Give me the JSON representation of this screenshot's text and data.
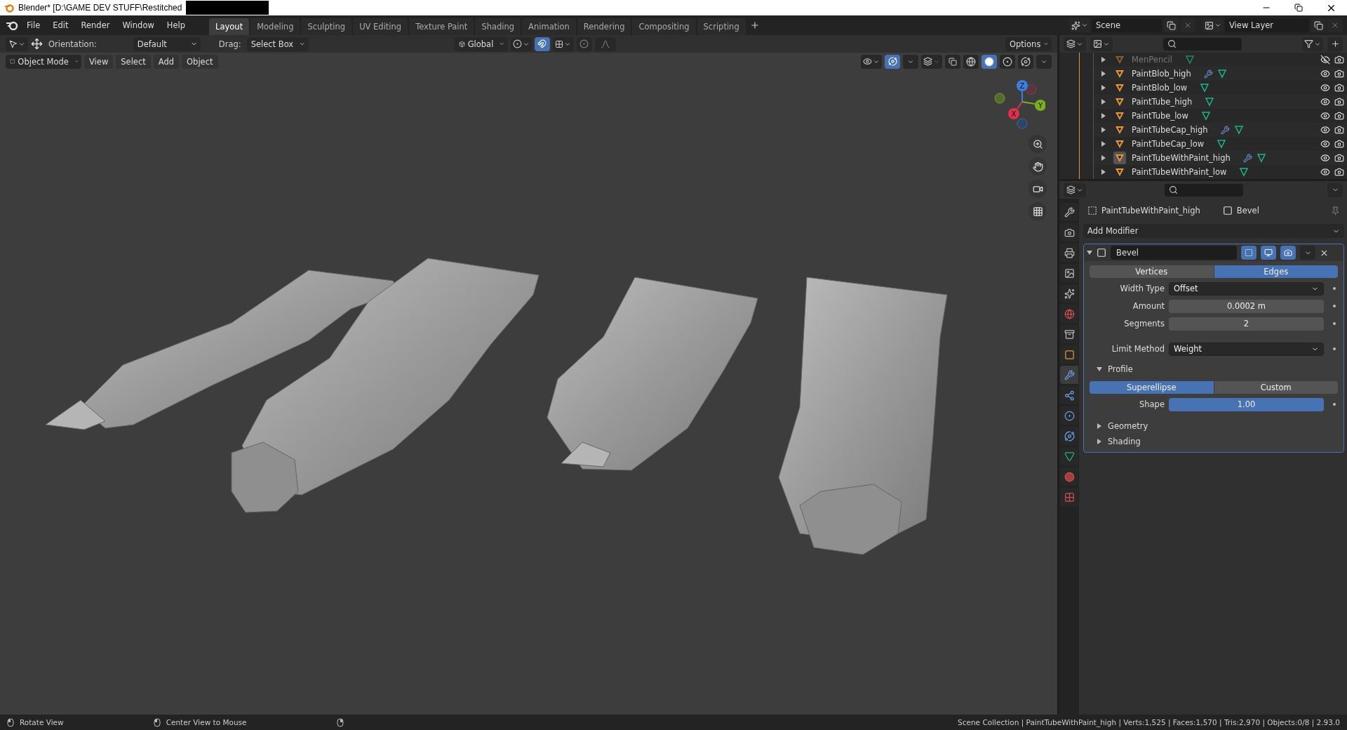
{
  "window": {
    "title": "Blender* [D:\\GAME DEV STUFF\\Restitched"
  },
  "menu": [
    "File",
    "Edit",
    "Render",
    "Window",
    "Help"
  ],
  "workspaces": [
    {
      "label": "Layout",
      "selected": true
    },
    {
      "label": "Modeling",
      "selected": false
    },
    {
      "label": "Sculpting",
      "selected": false
    },
    {
      "label": "UV Editing",
      "selected": false
    },
    {
      "label": "Texture Paint",
      "selected": false
    },
    {
      "label": "Shading",
      "selected": false
    },
    {
      "label": "Animation",
      "selected": false
    },
    {
      "label": "Rendering",
      "selected": false
    },
    {
      "label": "Compositing",
      "selected": false
    },
    {
      "label": "Scripting",
      "selected": false
    }
  ],
  "scene": "Scene",
  "view_layer": "View Layer",
  "tool_settings": {
    "orientation_label": "Orientation:",
    "orientation": "Default",
    "drag_label": "Drag:",
    "drag": "Select Box",
    "transform": "Global",
    "snap_on": true,
    "options": "Options"
  },
  "viewport_header": {
    "mode": "Object Mode",
    "menus": [
      "View",
      "Select",
      "Add",
      "Object"
    ],
    "gizmo_on": true,
    "shading": [
      {
        "kind": "wireframe",
        "selected": false
      },
      {
        "kind": "solid",
        "selected": true
      },
      {
        "kind": "material",
        "selected": false
      },
      {
        "kind": "rendered",
        "selected": false
      }
    ]
  },
  "gizmo": {
    "x": "X",
    "y": "Y",
    "z": "Z"
  },
  "outliner": {
    "items": [
      {
        "name": "MenPencil",
        "modifier": false,
        "visible": false,
        "active": false
      },
      {
        "name": "PaintBlob_high",
        "modifier": true,
        "visible": true,
        "active": false
      },
      {
        "name": "PaintBlob_low",
        "modifier": false,
        "visible": true,
        "active": false
      },
      {
        "name": "PaintTube_high",
        "modifier": false,
        "visible": true,
        "active": false
      },
      {
        "name": "PaintTube_low",
        "modifier": false,
        "visible": true,
        "active": false
      },
      {
        "name": "PaintTubeCap_high",
        "modifier": true,
        "visible": true,
        "active": false
      },
      {
        "name": "PaintTubeCap_low",
        "modifier": false,
        "visible": true,
        "active": false
      },
      {
        "name": "PaintTubeWithPaint_high",
        "modifier": true,
        "visible": true,
        "active": true
      },
      {
        "name": "PaintTubeWithPaint_low",
        "modifier": false,
        "visible": true,
        "active": false
      }
    ]
  },
  "property_tabs": [
    {
      "kind": "tool",
      "selected": false
    },
    {
      "kind": "render",
      "selected": false
    },
    {
      "kind": "output",
      "selected": false
    },
    {
      "kind": "view_layer",
      "selected": false
    },
    {
      "kind": "scene",
      "selected": false
    },
    {
      "kind": "world",
      "selected": false
    },
    {
      "kind": "collection",
      "selected": false
    },
    {
      "kind": "object",
      "selected": false
    },
    {
      "kind": "modifiers",
      "selected": true
    },
    {
      "kind": "particles",
      "selected": false
    },
    {
      "kind": "physics",
      "selected": false
    },
    {
      "kind": "constraints",
      "selected": false
    },
    {
      "kind": "data",
      "selected": false
    },
    {
      "kind": "material",
      "selected": false
    },
    {
      "kind": "texture",
      "selected": false
    }
  ],
  "properties": {
    "object": "PaintTubeWithPaint_high",
    "modifier": "Bevel",
    "add_modifier": "Add Modifier",
    "bevel": {
      "name": "Bevel",
      "expanded": true,
      "affect": [
        {
          "label": "Vertices",
          "selected": false
        },
        {
          "label": "Edges",
          "selected": true
        }
      ],
      "fields": [
        {
          "label": "Width Type",
          "value": "Offset",
          "kind": "dropdown"
        },
        {
          "label": "Amount",
          "value": "0.0002 m",
          "kind": "number"
        },
        {
          "label": "Segments",
          "value": "2",
          "kind": "number"
        },
        {
          "label": "Limit Method",
          "value": "Weight",
          "kind": "dropdown"
        }
      ],
      "profile": {
        "label": "Profile",
        "expanded": true,
        "types": [
          {
            "label": "Superellipse",
            "selected": true
          },
          {
            "label": "Custom",
            "selected": false
          }
        ],
        "shape_label": "Shape",
        "shape_value": "1.00",
        "level": 1
      },
      "sections": [
        {
          "label": "Geometry",
          "expanded": false
        },
        {
          "label": "Shading",
          "expanded": false
        }
      ]
    }
  },
  "status_bar": {
    "hints": [
      "Rotate View",
      "Center View to Mouse"
    ],
    "info": "Scene Collection | PaintTubeWithPaint_high | Verts:1,525 | Faces:1,570 | Tris:2,970 | Objects:0/8 | 2.93.0"
  }
}
